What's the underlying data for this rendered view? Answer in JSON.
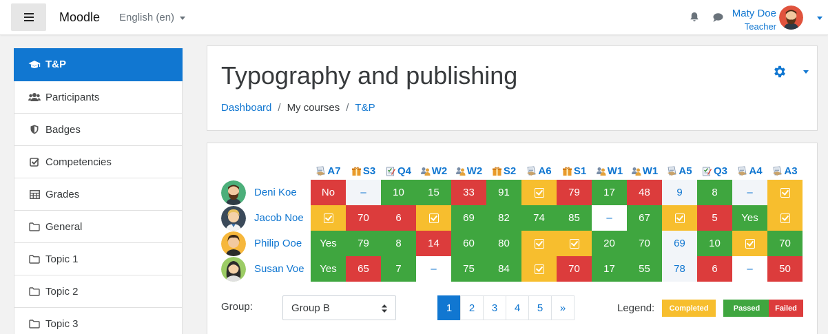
{
  "navbar": {
    "brand": "Moodle",
    "language": "English ‎(en)‎",
    "user_name": "Maty Doe",
    "user_role": "Teacher"
  },
  "sidebar": {
    "items": [
      {
        "label": "T&P",
        "icon": "graduation-cap-icon"
      },
      {
        "label": "Participants",
        "icon": "users-icon"
      },
      {
        "label": "Badges",
        "icon": "shield-icon"
      },
      {
        "label": "Competencies",
        "icon": "checkbox-icon"
      },
      {
        "label": "Grades",
        "icon": "table-icon"
      },
      {
        "label": "General",
        "icon": "folder-icon"
      },
      {
        "label": "Topic 1",
        "icon": "folder-icon"
      },
      {
        "label": "Topic 2",
        "icon": "folder-icon"
      },
      {
        "label": "Topic 3",
        "icon": "folder-icon"
      }
    ]
  },
  "header": {
    "title": "Typography and publishing",
    "breadcrumb": [
      "Dashboard",
      "My courses",
      "T&P"
    ]
  },
  "grid": {
    "columns": [
      {
        "label": "A7",
        "icon": "assignment-icon"
      },
      {
        "label": "S3",
        "icon": "scorm-icon"
      },
      {
        "label": "Q4",
        "icon": "quiz-icon"
      },
      {
        "label": "W2",
        "icon": "workshop-icon"
      },
      {
        "label": "W2",
        "icon": "workshop-icon"
      },
      {
        "label": "S2",
        "icon": "scorm-icon"
      },
      {
        "label": "A6",
        "icon": "assignment-icon"
      },
      {
        "label": "S1",
        "icon": "scorm-icon"
      },
      {
        "label": "W1",
        "icon": "workshop-icon"
      },
      {
        "label": "W1",
        "icon": "workshop-icon"
      },
      {
        "label": "A5",
        "icon": "assignment-icon"
      },
      {
        "label": "Q3",
        "icon": "quiz-icon"
      },
      {
        "label": "A4",
        "icon": "assignment-icon"
      },
      {
        "label": "A3",
        "icon": "assignment-icon"
      }
    ],
    "students": [
      {
        "name": "Deni Koe",
        "avatar": "bearded-man",
        "cells": [
          [
            "failed",
            "No"
          ],
          [
            "num",
            "–"
          ],
          [
            "passed",
            "10"
          ],
          [
            "passed",
            "15"
          ],
          [
            "failed",
            "33"
          ],
          [
            "passed",
            "91"
          ],
          [
            "completed",
            "check"
          ],
          [
            "failed",
            "79"
          ],
          [
            "passed",
            "17"
          ],
          [
            "failed",
            "48"
          ],
          [
            "num",
            "9"
          ],
          [
            "passed",
            "8"
          ],
          [
            "num",
            "–"
          ],
          [
            "completed",
            "check"
          ]
        ]
      },
      {
        "name": "Jacob Noe",
        "avatar": "blond-man",
        "cells": [
          [
            "completed",
            "check"
          ],
          [
            "failed",
            "70"
          ],
          [
            "failed",
            "6"
          ],
          [
            "completed",
            "check"
          ],
          [
            "passed",
            "69"
          ],
          [
            "passed",
            "82"
          ],
          [
            "passed",
            "74"
          ],
          [
            "passed",
            "85"
          ],
          [
            "dash",
            "–"
          ],
          [
            "passed",
            "67"
          ],
          [
            "completed",
            "check"
          ],
          [
            "failed",
            "5"
          ],
          [
            "passed",
            "Yes"
          ],
          [
            "completed",
            "check"
          ]
        ]
      },
      {
        "name": "Philip Ooe",
        "avatar": "dark-hair-man",
        "cells": [
          [
            "passed",
            "Yes"
          ],
          [
            "passed",
            "79"
          ],
          [
            "passed",
            "8"
          ],
          [
            "failed",
            "14"
          ],
          [
            "passed",
            "60"
          ],
          [
            "passed",
            "80"
          ],
          [
            "completed",
            "check"
          ],
          [
            "completed",
            "check"
          ],
          [
            "passed",
            "20"
          ],
          [
            "passed",
            "70"
          ],
          [
            "num",
            "69"
          ],
          [
            "passed",
            "10"
          ],
          [
            "completed",
            "check"
          ],
          [
            "passed",
            "70"
          ]
        ]
      },
      {
        "name": "Susan Voe",
        "avatar": "woman",
        "cells": [
          [
            "passed",
            "Yes"
          ],
          [
            "failed",
            "65"
          ],
          [
            "passed",
            "7"
          ],
          [
            "dash",
            "–"
          ],
          [
            "passed",
            "75"
          ],
          [
            "passed",
            "84"
          ],
          [
            "completed",
            "check"
          ],
          [
            "failed",
            "70"
          ],
          [
            "passed",
            "17"
          ],
          [
            "passed",
            "55"
          ],
          [
            "num",
            "78"
          ],
          [
            "failed",
            "6"
          ],
          [
            "dash",
            "–"
          ],
          [
            "failed",
            "50"
          ]
        ]
      }
    ]
  },
  "controls": {
    "group_label": "Group:",
    "group_value": "Group B",
    "pages": [
      "1",
      "2",
      "3",
      "4",
      "5",
      "»"
    ],
    "active_page": "1",
    "legend_label": "Legend:",
    "legend": [
      {
        "label": "Completed",
        "color": "#f7be2e"
      },
      {
        "label": "Passed",
        "color": "#3fa63f"
      },
      {
        "label": "Failed",
        "color": "#dc3c3c"
      }
    ]
  },
  "colors": {
    "accent": "#1177d1",
    "passed": "#3fa63f",
    "failed": "#dc3c3c",
    "completed": "#f7be2e"
  }
}
